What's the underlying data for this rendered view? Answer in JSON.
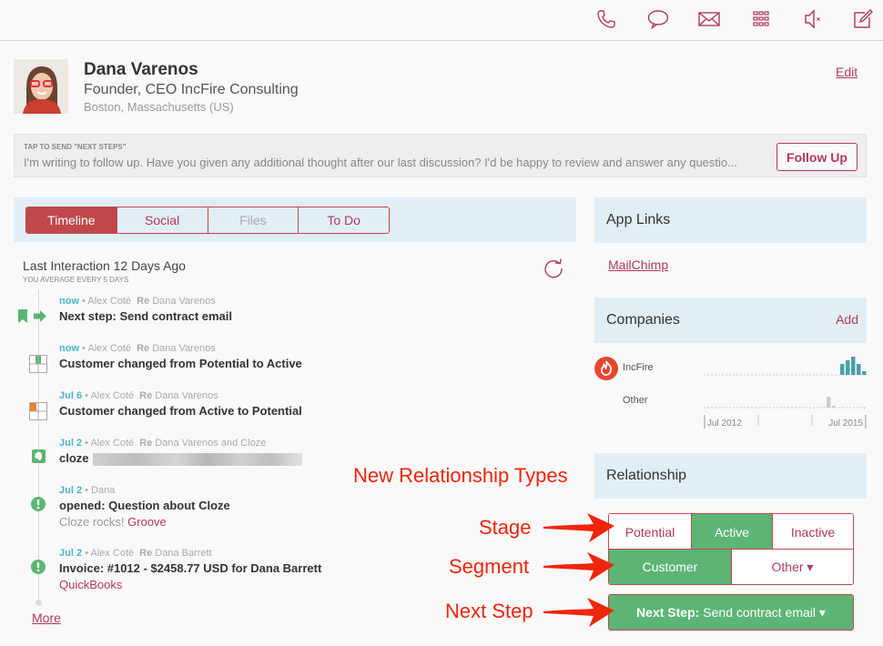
{
  "toolbar": {
    "icons": [
      "phone-icon",
      "chat-icon",
      "mail-icon",
      "grid-icon",
      "mute-icon",
      "compose-icon"
    ]
  },
  "contact": {
    "name": "Dana Varenos",
    "title": "Founder, CEO IncFire Consulting",
    "location": "Boston, Massachusetts (US)",
    "edit_label": "Edit"
  },
  "followup": {
    "label": "TAP TO SEND \"NEXT STEPS\"",
    "message": "I'm writing to follow up. Have you given any additional thought after our last discussion? I'd be happy to review and answer any questio...",
    "button_label": "Follow Up"
  },
  "tabs": [
    {
      "label": "Timeline",
      "state": "active"
    },
    {
      "label": "Social",
      "state": "normal"
    },
    {
      "label": "Files",
      "state": "disabled"
    },
    {
      "label": "To Do",
      "state": "normal"
    }
  ],
  "interaction": {
    "last": "Last Interaction 12 Days Ago",
    "average": "YOU AVERAGE EVERY 5 DAYS"
  },
  "timeline": [
    {
      "when": "now",
      "who": "Alex Coté",
      "re_label": "Re",
      "re": "Dana Varenos",
      "main": "Next step: Send contract email",
      "icon": "next-step-icon"
    },
    {
      "when": "now",
      "who": "Alex Coté",
      "re_label": "Re",
      "re": "Dana Varenos",
      "main": "Customer changed from Potential to Active",
      "icon": "stage-change-icon"
    },
    {
      "when": "Jul 6",
      "who": "Alex Coté",
      "re_label": "Re",
      "re": "Dana Varenos",
      "main": "Customer changed from Active to Potential",
      "icon": "stage-change-icon"
    },
    {
      "when": "Jul 2",
      "who": "Alex Coté",
      "re_label": "Re",
      "re": "Dana Varenos and Cloze",
      "main": "cloze",
      "icon": "evernote-icon"
    },
    {
      "when": "Jul 2",
      "who": "Dana",
      "main": "opened: Question about Cloze",
      "sub": "Cloze rocks!",
      "sub_link": "Groove",
      "icon": "alert-icon"
    },
    {
      "when": "Jul 2",
      "who": "Alex Coté",
      "re_label": "Re",
      "re": "Dana Barrett",
      "main": "Invoice: #1012 - $2458.77 USD for Dana Barrett",
      "link": "QuickBooks",
      "icon": "alert-icon"
    }
  ],
  "more_label": "More",
  "app_links": {
    "title": "App Links",
    "links": [
      "MailChimp"
    ]
  },
  "companies": {
    "title": "Companies",
    "add_label": "Add",
    "rows": [
      {
        "name": "IncFire",
        "activity": [
          3,
          4,
          5,
          3,
          1
        ]
      },
      {
        "name": "Other",
        "activity": [
          3,
          0.5
        ]
      }
    ],
    "axis_labels": [
      "Jul 2012",
      "Jul 2015"
    ]
  },
  "relationship": {
    "title": "Relationship",
    "stage": [
      {
        "label": "Potential",
        "selected": false
      },
      {
        "label": "Active",
        "selected": true
      },
      {
        "label": "Inactive",
        "selected": false
      }
    ],
    "segment": [
      {
        "label": "Customer",
        "selected": true
      },
      {
        "label": "Other ▾",
        "selected": false
      }
    ],
    "next_step_label": "Next Step:",
    "next_step_value": "Send contract email ▾"
  },
  "annotations": {
    "types": "New Relationship Types",
    "stage": "Stage",
    "segment": "Segment",
    "next_step": "Next Step"
  }
}
